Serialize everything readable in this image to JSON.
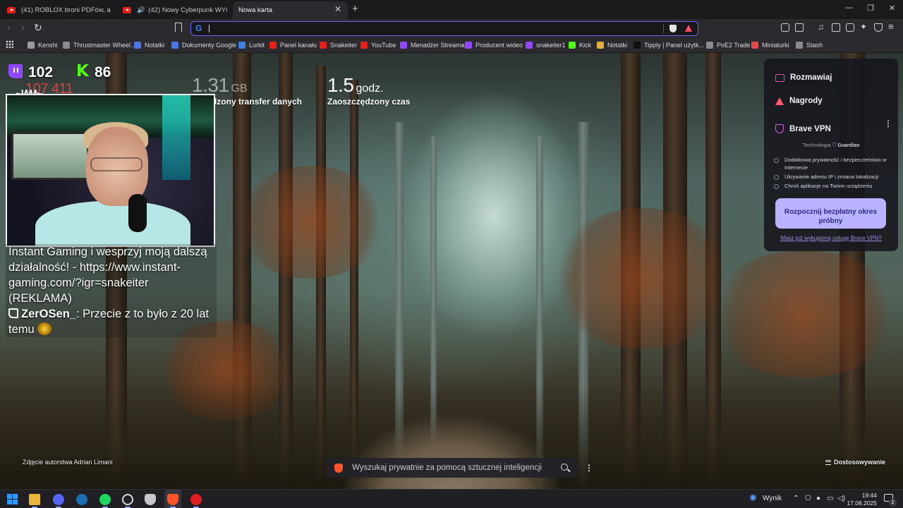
{
  "tabs": [
    {
      "label": "(41) ROBLOX broni PDFów, a Masters"
    },
    {
      "label": "(42) Nowy Cyberpunk WYGLĄDA"
    },
    {
      "label": "Nowa karta"
    }
  ],
  "address_bar": {
    "value": "",
    "search_engine_icon": "G"
  },
  "bookmarks": [
    {
      "label": "Kenshi",
      "icon_color": "#9a9aa0"
    },
    {
      "label": "Thrustmaster Wheel...",
      "icon_color": "#8a8a90"
    },
    {
      "label": "Notatki",
      "icon_color": "#4a76e8"
    },
    {
      "label": "Dokumenty Google",
      "icon_color": "#4a76e8"
    },
    {
      "label": "Lurkit",
      "icon_color": "#3f7fe0"
    },
    {
      "label": "Panel kanału",
      "icon_color": "#e62117"
    },
    {
      "label": "Snakeiter",
      "icon_color": "#e62117"
    },
    {
      "label": "YouTube",
      "icon_color": "#e62117"
    },
    {
      "label": "Menadżer Streama",
      "icon_color": "#9147ff"
    },
    {
      "label": "Producent wideo",
      "icon_color": "#9147ff"
    },
    {
      "label": "snakeiter1",
      "icon_color": "#9147ff"
    },
    {
      "label": "Kick",
      "icon_color": "#53fc18"
    },
    {
      "label": "Notatki",
      "icon_color": "#e0b040"
    },
    {
      "label": "Tipply | Panel użytk...",
      "icon_color": "#111111"
    },
    {
      "label": "PoE2 Trade",
      "icon_color": "#8a8a90"
    },
    {
      "label": "Miniaturki",
      "icon_color": "#e04a4a"
    },
    {
      "label": "Stash",
      "icon_color": "#8a8a90"
    }
  ],
  "stats": [
    {
      "value": "1.31",
      "unit": "GB",
      "label": "Zaoszczędzony transfer danych"
    },
    {
      "value": "1.5",
      "unit": "godz.",
      "label": "Zaoszczędzony czas"
    }
  ],
  "stream_overlay": {
    "twitch_viewers": "102",
    "kick_viewers": "86",
    "red_counter": "107 411",
    "chat_messages": [
      {
        "user": "",
        "text": "Instant Gaming i wesprzyj moją dalszą działalność! - https://www.instant-gaming.com/?igr=snakeiter (REKLAMA)"
      },
      {
        "user": "ZerOSen_",
        "text": ": Przecie z to było z 20 lat temu"
      }
    ]
  },
  "brave_panel": {
    "items": [
      "Rozmawiaj",
      "Nagrody",
      "Brave VPN"
    ],
    "tech_label": "Technologia",
    "tech_brand": "Guardian",
    "features": [
      "Dodatkowa prywatność i bezpieczeństwo w Internecie",
      "Ukrywanie adresu IP i zmiana lokalizacji",
      "Chroń aplikacje na Twoim urządzeniu"
    ],
    "cta": "Rozpocznij bezpłatny okres próbny",
    "link": "Masz już wykupioną usługę Brave VPN?"
  },
  "photo_credit": "Zdjęcie autorstwa Adrian Limani",
  "search": {
    "placeholder": "Wyszukaj prywatnie za pomocą sztucznej inteligencji"
  },
  "customize_label": "Dostosowywanie",
  "taskbar": {
    "weather_label": "Wynik",
    "time": "19:44",
    "date": "17.08.2025",
    "notification_count": "2"
  },
  "colors": {
    "accent": "#6b63ff",
    "brave_orange": "#fb542b",
    "cta_bg": "#b9b3ff"
  }
}
